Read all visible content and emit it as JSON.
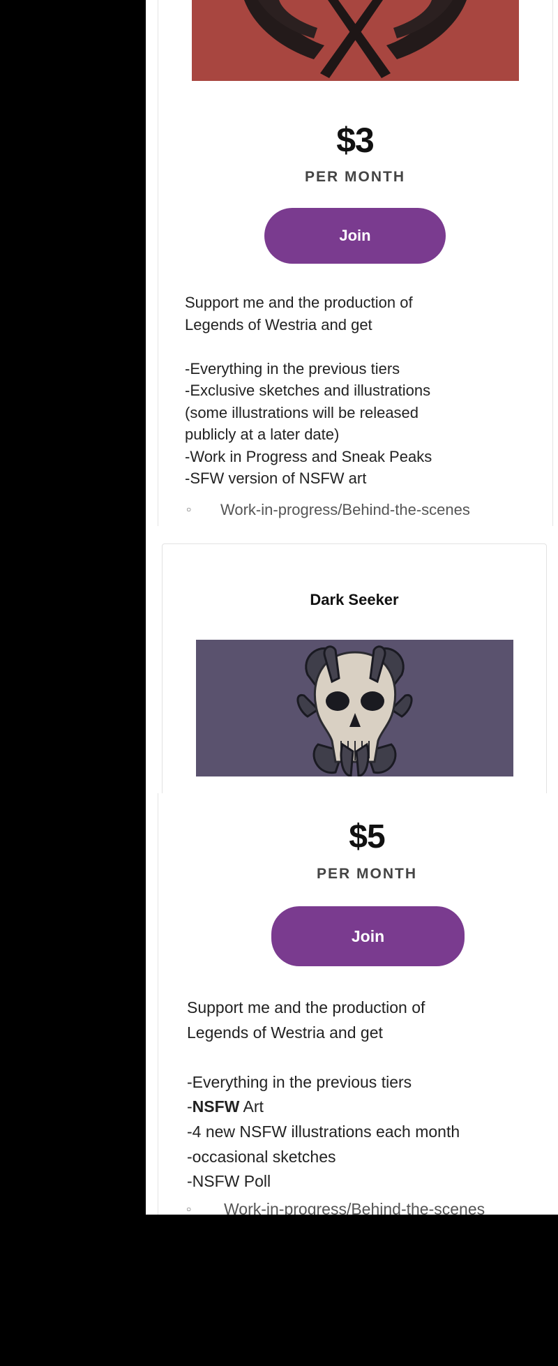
{
  "tier_one": {
    "price": "$3",
    "per_month": "PER MONTH",
    "join_label": "Join",
    "description": [
      "Support me and the production of",
      "Legends of Westria and get",
      "",
      "-Everything in the previous tiers",
      "-Exclusive sketches and illustrations",
      "(some illustrations will be released",
      "publicly at a later date)",
      "-Work in Progress and Sneak Peaks",
      "-SFW version of NSFW art"
    ],
    "benefit": "Work-in-progress/Behind-the-scenes"
  },
  "tier_two": {
    "title": "Dark Seeker",
    "price": "$5",
    "per_month": "PER MONTH",
    "join_label": "Join",
    "description": {
      "intro_1": "Support me and the production of",
      "intro_2": "Legends of Westria and get",
      "line_1": "-Everything in the previous tiers",
      "line_2_bold": "NSFW",
      "line_2_prefix": "-",
      "line_2_suffix": " Art",
      "line_3": "-4 new NSFW illustrations each month",
      "line_4": "-occasional sketches",
      "line_5": "-NSFW Poll"
    },
    "benefit": "Work-in-progress/Behind-the-scenes"
  },
  "colors": {
    "join_button": "#7a3b8f",
    "banner_red": "#a84640",
    "banner_purple": "#5a526e"
  }
}
